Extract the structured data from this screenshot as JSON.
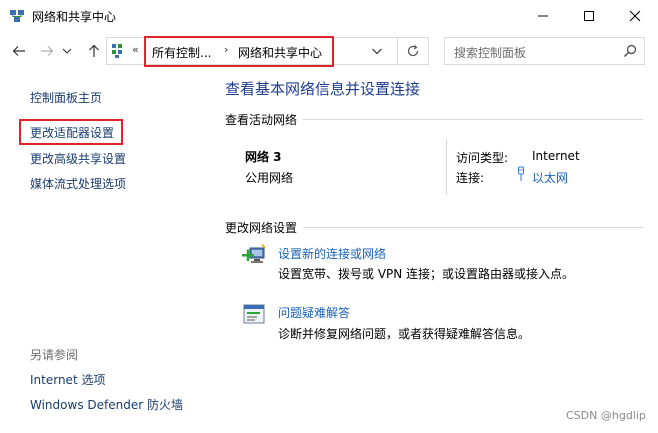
{
  "window": {
    "title": "网络和共享中心",
    "icon": "network-center-icon",
    "controls": [
      "minimize-icon",
      "maximize-icon",
      "close-icon"
    ]
  },
  "nav": {
    "back_icon": "arrow-left-icon",
    "forward_icon": "arrow-right-icon",
    "recent_icon": "chevron-down-icon",
    "up_icon": "arrow-up-icon"
  },
  "address": {
    "overflow": "«",
    "crumbs": [
      "所有控制...",
      "网络和共享中心"
    ],
    "separator": "›",
    "dropdown_icon": "chevron-down-icon",
    "refresh_icon": "refresh-icon"
  },
  "search": {
    "placeholder": "搜索控制面板",
    "icon": "search-icon"
  },
  "leftnav": {
    "home": "控制面板主页",
    "adapter": "更改适配器设置",
    "advanced": "更改高级共享设置",
    "media": "媒体流式处理选项",
    "seealso_title": "另请参阅",
    "internet_options": "Internet 选项",
    "defender": "Windows Defender 防火墙"
  },
  "main": {
    "title": "查看基本网络信息并设置连接",
    "active_section": "查看活动网络",
    "network": {
      "name": "网络 3",
      "category": "公用网络",
      "access_label": "访问类型:",
      "access_value": "Internet",
      "connections_label": "连接:",
      "connections_value": "以太网"
    },
    "change_section": "更改网络设置",
    "tasks": [
      {
        "link": "设置新的连接或网络",
        "desc": "设置宽带、拨号或 VPN 连接；或设置路由器或接入点。",
        "icon": "new-connection-icon"
      },
      {
        "link": "问题疑难解答",
        "desc": "诊断并修复网络问题，或者获得疑难解答信息。",
        "icon": "troubleshoot-icon"
      }
    ]
  },
  "watermark": "CSDN @hgdlip",
  "colors": {
    "link_blue": "#1a62b8",
    "nav_text": "#1a3d6e",
    "title_blue": "#1e3d8f",
    "highlight_red": "#e0242a"
  }
}
